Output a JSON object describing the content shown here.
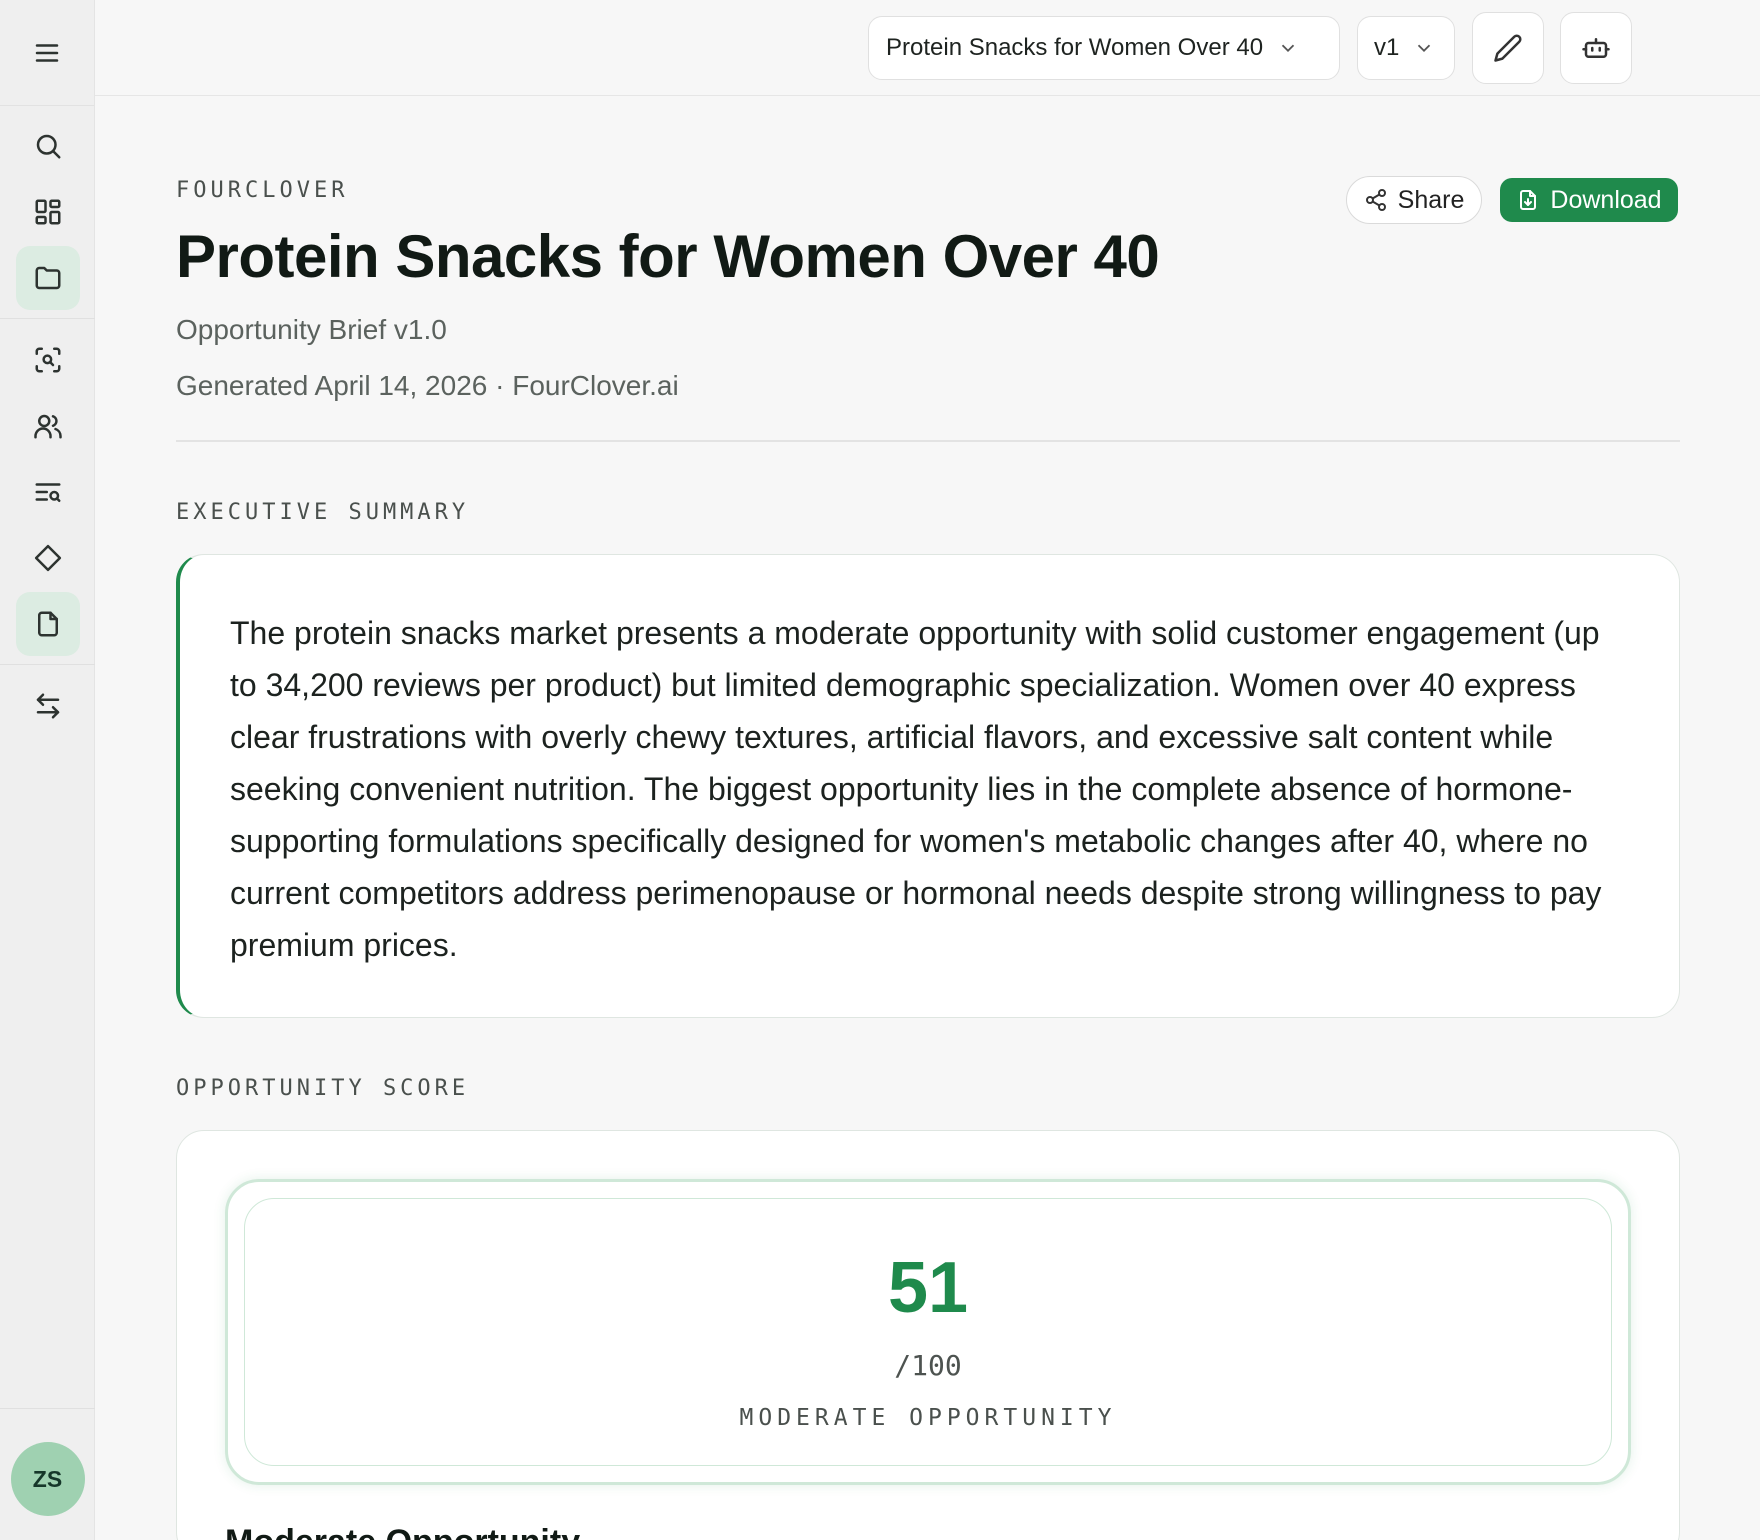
{
  "sidebar": {
    "menu_icon": "menu-icon",
    "items": [
      {
        "name": "search",
        "icon": "search-icon"
      },
      {
        "name": "dashboard",
        "icon": "grid-icon"
      },
      {
        "name": "projects",
        "icon": "folder-icon",
        "active": true
      },
      {
        "name": "scan",
        "icon": "scan-search-icon"
      },
      {
        "name": "audience",
        "icon": "users-icon"
      },
      {
        "name": "research",
        "icon": "text-search-icon"
      },
      {
        "name": "opportunities",
        "icon": "diamond-icon"
      },
      {
        "name": "briefs",
        "icon": "file-icon",
        "active": true
      },
      {
        "name": "compare",
        "icon": "swap-icon"
      }
    ],
    "avatar_initials": "ZS"
  },
  "topbar": {
    "project_select": "Protein Snacks for Women Over 40",
    "version_select": "v1",
    "edit_icon": "pencil-icon",
    "assistant_icon": "bot-icon"
  },
  "header": {
    "brand": "FOURCLOVER",
    "title": "Protein Snacks for Women Over 40",
    "subtitle": "Opportunity Brief v1.0",
    "meta": "Generated April 14, 2026 · FourClover.ai",
    "share_label": "Share",
    "download_label": "Download"
  },
  "executive_summary": {
    "heading": "EXECUTIVE SUMMARY",
    "text": "The protein snacks market presents a moderate opportunity with solid customer engagement (up to 34,200 reviews per product) but limited demographic specialization. Women over 40 express clear frustrations with overly chewy textures, artificial flavors, and excessive salt content while seeking convenient nutrition. The biggest opportunity lies in the complete absence of hormone-supporting formulations specifically designed for women's metabolic changes after 40, where no current competitors address perimenopause or hormonal needs despite strong willingness to pay premium prices."
  },
  "opportunity_score": {
    "heading": "OPPORTUNITY SCORE",
    "value": "51",
    "max": "/100",
    "label": "MODERATE OPPORTUNITY",
    "next_heading": "Moderate Opportunity"
  },
  "colors": {
    "accent": "#1f8a4c",
    "active_bg": "#dcece2",
    "avatar_bg": "#9fd1b1"
  }
}
